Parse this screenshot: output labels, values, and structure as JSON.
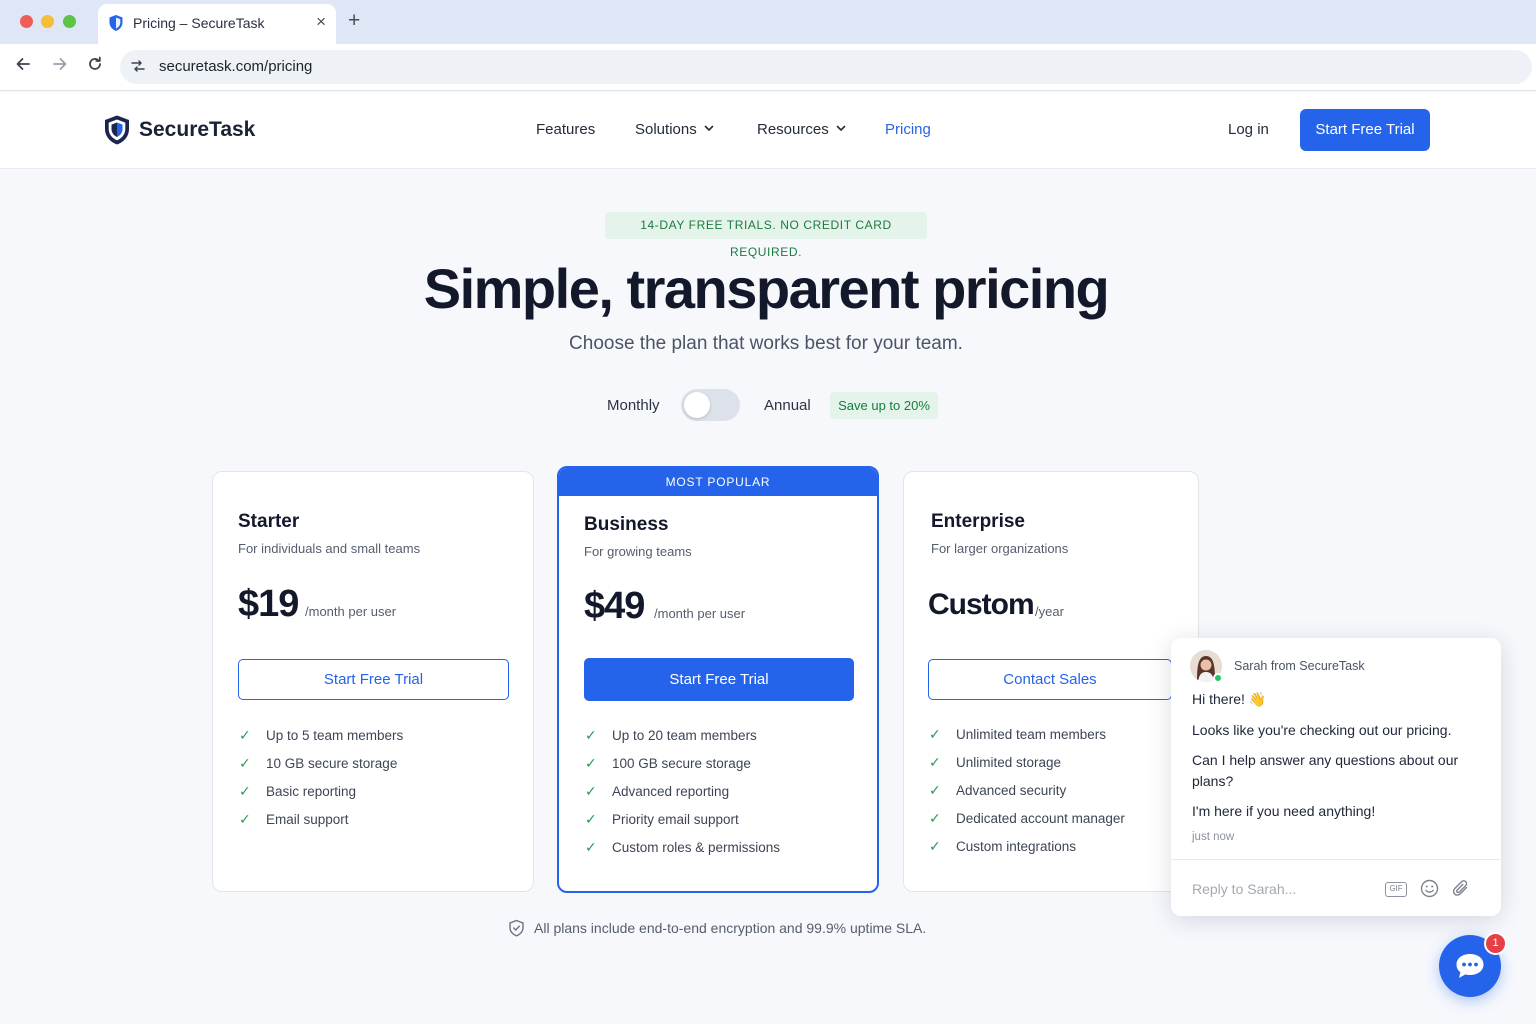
{
  "browser": {
    "tab_title": "Pricing – SecureTask",
    "close_glyph": "×",
    "new_tab_glyph": "+",
    "url": "securetask.com/pricing",
    "icons": [
      "shield-icon",
      "back-arrow-icon",
      "forward-arrow-icon",
      "reload-icon",
      "site-settings-icon"
    ]
  },
  "header": {
    "logo_text": "SecureTask",
    "menu": [
      {
        "label": "Features",
        "dropdown": false,
        "active": false
      },
      {
        "label": "Solutions",
        "dropdown": true,
        "active": false
      },
      {
        "label": "Resources",
        "dropdown": true,
        "active": false
      },
      {
        "label": "Pricing",
        "dropdown": false,
        "active": true
      }
    ],
    "login_label": "Log in",
    "cta_label": "Start Free Trial"
  },
  "hero": {
    "badge": "14-DAY FREE TRIALS. NO CREDIT CARD REQUIRED.",
    "title": "Simple, transparent pricing",
    "subtitle": "Choose the plan that works best for your team."
  },
  "billing_toggle": {
    "monthly_label": "Monthly",
    "annual_label": "Annual",
    "save_badge": "Save up to 20%",
    "selected": "Monthly"
  },
  "plans": [
    {
      "name": "Starter",
      "description": "For individuals and small teams",
      "price": "$19",
      "unit": "/month per user",
      "button": "Start Free Trial",
      "features": [
        "Up to 5 team members",
        "10 GB secure storage",
        "Basic reporting",
        "Email support"
      ]
    },
    {
      "name": "Business",
      "banner": "MOST POPULAR",
      "description": "For growing teams",
      "price": "$49",
      "unit": "/month per user",
      "button": "Start Free Trial",
      "features": [
        "Up to 20 team members",
        "100 GB secure storage",
        "Advanced reporting",
        "Priority email support",
        "Custom roles & permissions"
      ]
    },
    {
      "name": "Enterprise",
      "description": "For larger organizations",
      "price": "Custom",
      "unit": "/year",
      "button": "Contact Sales",
      "features": [
        "Unlimited team members",
        "Unlimited storage",
        "Advanced security",
        "Dedicated account manager",
        "Custom integrations"
      ]
    }
  ],
  "footnote": "All plans include end-to-end encryption and 99.9% uptime SLA.",
  "chat": {
    "from": "Sarah from SecureTask",
    "messages": [
      "Hi there! 👋",
      "Looks like you're checking out our pricing.",
      "Can I help answer any questions about our plans?",
      "I'm here if you need anything!"
    ],
    "time": "just now",
    "input_placeholder": "Reply to Sarah...",
    "gif_label": "GIF",
    "unread_count": "1"
  },
  "colors": {
    "accent": "#2563eb",
    "success": "#2a9a55",
    "badge_bg": "#e4f4ea",
    "notification": "#e54046"
  }
}
